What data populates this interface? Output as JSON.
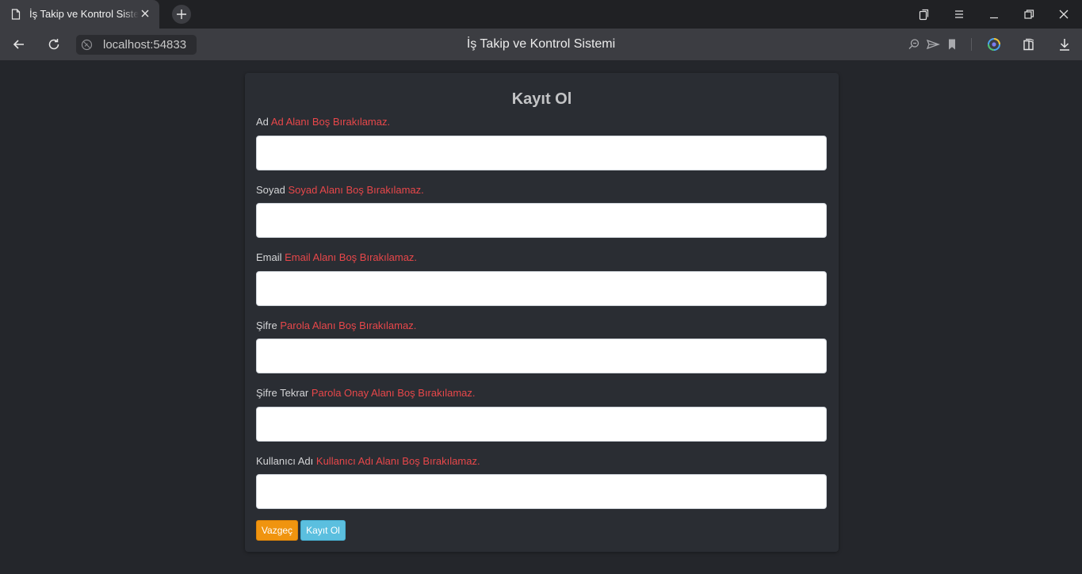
{
  "browser": {
    "tab": {
      "title": "İş Takip ve Kontrol Sistemi"
    },
    "address": {
      "url": "localhost:54833"
    },
    "page_title": "İş Takip ve Kontrol Sistemi"
  },
  "form": {
    "title": "Kayıt Ol",
    "fields": [
      {
        "label": "Ad",
        "error": "Ad Alanı Boş Bırakılamaz.",
        "value": ""
      },
      {
        "label": "Soyad",
        "error": "Soyad Alanı Boş Bırakılamaz.",
        "value": ""
      },
      {
        "label": "Email",
        "error": "Email Alanı Boş Bırakılamaz.",
        "value": ""
      },
      {
        "label": "Şifre",
        "error": "Parola Alanı Boş Bırakılamaz.",
        "value": ""
      },
      {
        "label": "Şifre Tekrar",
        "error": "Parola Onay Alanı Boş Bırakılamaz.",
        "value": ""
      },
      {
        "label": "Kullanıcı Adı",
        "error": "Kullanıcı Adı Alanı Boş Bırakılamaz.",
        "value": ""
      }
    ],
    "buttons": {
      "cancel": "Vazgeç",
      "submit": "Kayıt Ol"
    }
  },
  "colors": {
    "error": "#e8474a",
    "cancel_button": "#f0940f",
    "submit_button": "#5bbfdf",
    "page_background": "#24262b",
    "card_background": "#2a2d33"
  },
  "icons": [
    "page-icon",
    "close-icon",
    "plus-icon",
    "collections-icon",
    "menu-icon",
    "minimize-icon",
    "restore-icon",
    "back-icon",
    "reload-icon",
    "site-info-icon",
    "zoom-icon",
    "send-icon",
    "bookmark-icon",
    "copilot-icon",
    "extensions-icon",
    "download-icon"
  ]
}
